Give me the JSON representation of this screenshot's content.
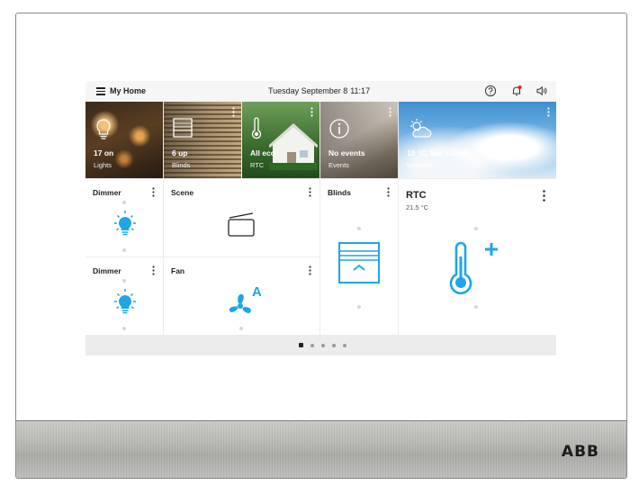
{
  "header": {
    "title": "My Home",
    "date": "Tuesday  September 8",
    "time": "11:17"
  },
  "status_tiles": [
    {
      "value": "17 on",
      "caption": "Lights",
      "icon": "bulb-icon"
    },
    {
      "value": "6 up",
      "caption": "Blinds",
      "icon": "blinds-icon"
    },
    {
      "value": "All eco",
      "caption": "RTC",
      "icon": "thermometer-icon"
    },
    {
      "value": "No events",
      "caption": "Events",
      "icon": "info-icon"
    },
    {
      "value": "19 °C, few clouds",
      "caption": "Weather",
      "icon": "cloud-sun-icon"
    }
  ],
  "cards": {
    "dimmer1": {
      "title": "Dimmer",
      "icon": "bulb-icon"
    },
    "scene": {
      "title": "Scene",
      "icon": "scene-icon"
    },
    "blinds": {
      "title": "Blinds",
      "icon": "blinds-icon"
    },
    "rtc": {
      "title": "RTC",
      "temperature": "21.5 °C",
      "icon": "thermometer-plus-icon"
    },
    "dimmer2": {
      "title": "Dimmer",
      "icon": "bulb-icon"
    },
    "fan": {
      "title": "Fan",
      "icon": "fan-auto-icon",
      "mode_badge": "A"
    }
  },
  "pager": {
    "pages": 5,
    "active": 0
  },
  "device": {
    "brand": "ABB"
  },
  "colors": {
    "accent": "#1ea5e6",
    "tile_bg": "#ffffff",
    "screen_bg": "#ececec"
  }
}
